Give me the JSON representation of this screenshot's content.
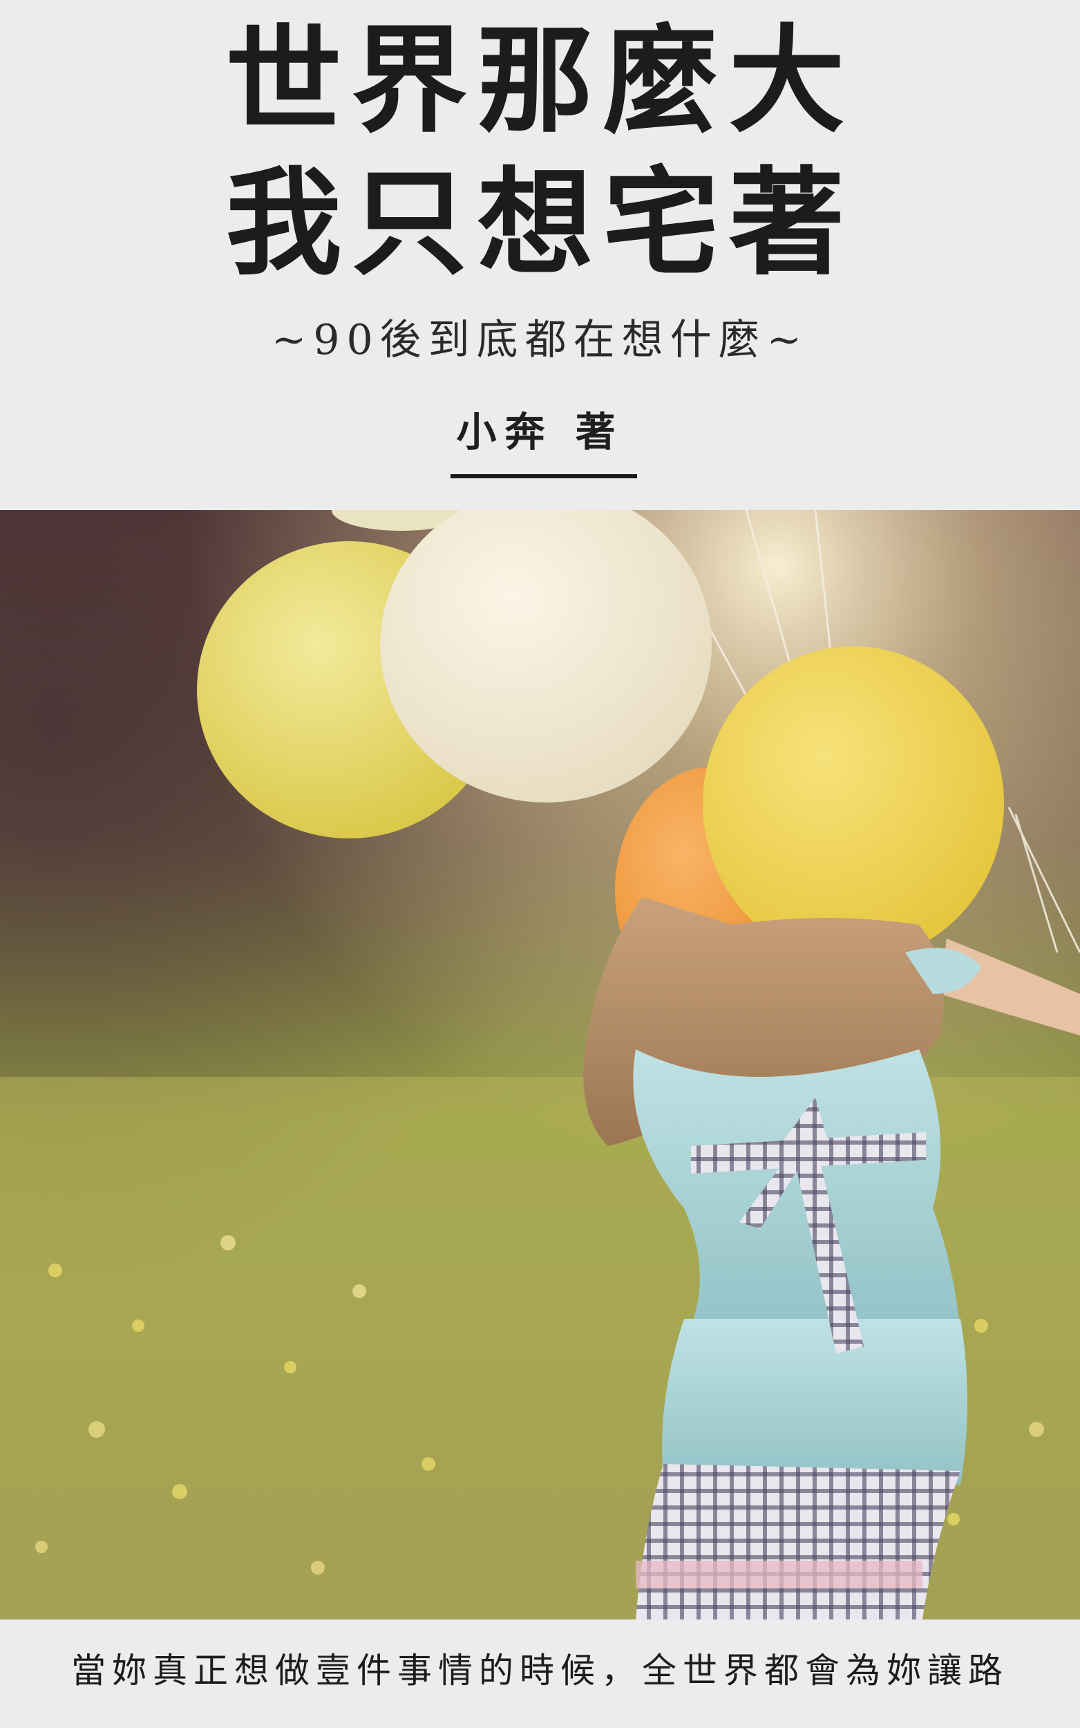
{
  "cover": {
    "title_line1": "世界那麼大",
    "title_line2": "我只想宅著",
    "subtitle": "~90後到底都在想什麼~",
    "author": "小奔 著",
    "tagline": "當妳真正想做壹件事情的時候，全世界都會為妳讓路"
  },
  "colors": {
    "background": "#ececec",
    "text": "#1c1c1c",
    "balloon_yellow": "#e8d25a",
    "balloon_cream": "#f1e8cf",
    "balloon_orange": "#f39a3d",
    "dress_blue": "#a9d3d6"
  }
}
